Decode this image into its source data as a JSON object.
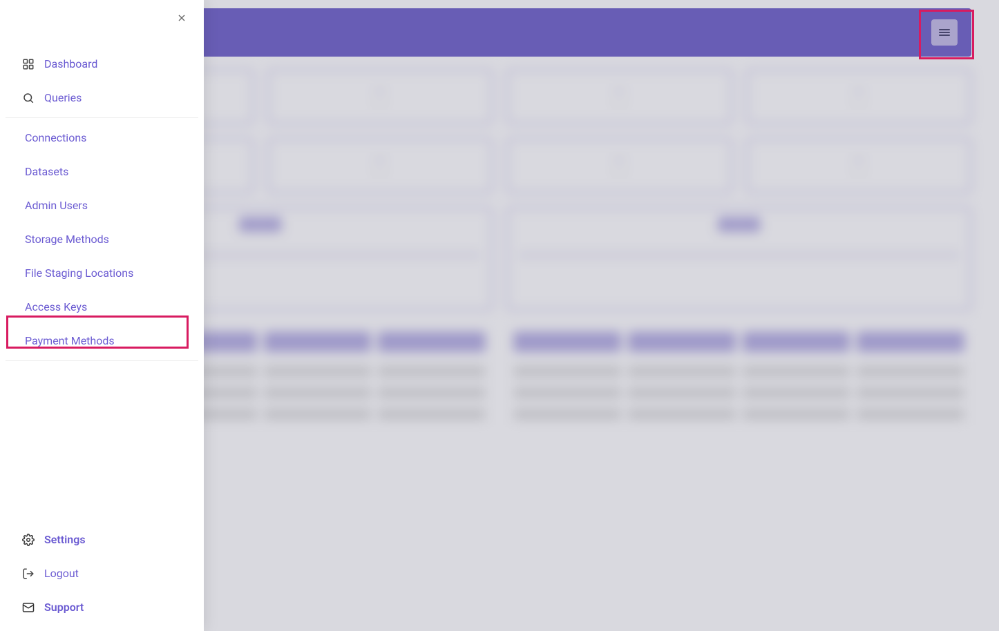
{
  "sidebar": {
    "top_items": [
      {
        "label": "Dashboard",
        "icon": "grid"
      },
      {
        "label": "Queries",
        "icon": "search"
      }
    ],
    "middle_items": [
      {
        "label": "Connections"
      },
      {
        "label": "Datasets"
      },
      {
        "label": "Admin Users"
      },
      {
        "label": "Storage Methods"
      },
      {
        "label": "File Staging Locations"
      },
      {
        "label": "Access Keys"
      },
      {
        "label": "Payment Methods"
      }
    ],
    "bottom_items": [
      {
        "label": "Settings",
        "icon": "gear"
      },
      {
        "label": "Logout",
        "icon": "logout"
      },
      {
        "label": "Support",
        "icon": "mail"
      }
    ]
  },
  "cards": {
    "row1": [
      {
        "value": "",
        "label": ""
      },
      {
        "value": "",
        "label": ""
      },
      {
        "value": "",
        "label": ""
      },
      {
        "value": "",
        "label": ""
      }
    ],
    "row2": [
      {
        "value": "",
        "label": ""
      },
      {
        "value": "",
        "label": ""
      },
      {
        "value": "",
        "label": ""
      },
      {
        "value": "",
        "label": ""
      }
    ]
  }
}
